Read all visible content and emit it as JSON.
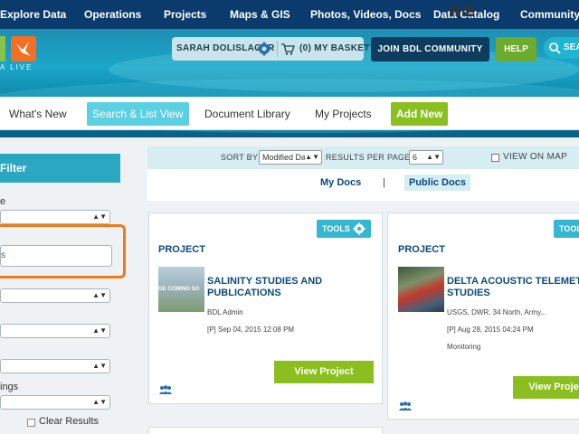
{
  "topnav": {
    "items": [
      "Explore Data",
      "Operations",
      "Projects",
      "Maps & GIS",
      "Photos, Videos, Docs",
      "Data Catalog",
      "Community"
    ]
  },
  "banner": {
    "logo_text": "A LIVE",
    "user_name": "SARAH DOLISLAGER",
    "basket": "(0) MY BASKET",
    "join": "JOIN BDL COMMUNITY",
    "help": "HELP",
    "search": "SEA"
  },
  "subnav": {
    "items": [
      "What's New",
      "Search & List View",
      "Document Library",
      "My Projects"
    ],
    "add": "Add New",
    "active_index": 1
  },
  "sidebar": {
    "filter_title": "Filter",
    "label_1": "e",
    "input_value": "s",
    "label_2": "ings",
    "clear": "Clear Results"
  },
  "toolbar": {
    "sort_by": "SORT BY",
    "sort_value": "Modified Da",
    "results_per_page": "RESULTS PER PAGE",
    "per_page_value": "6",
    "view_on_map": "VIEW ON MAP"
  },
  "doc_tabs": {
    "my_docs": "My Docs",
    "separator": "|",
    "public_docs": "Public Docs"
  },
  "cards": [
    {
      "tools": "TOOLS",
      "type": "PROJECT",
      "thumb_text": "GE COMING SO",
      "title_line1": "SALINITY STUDIES AND",
      "title_line2": "PUBLICATIONS",
      "author": "BDL Admin",
      "date": "[P] Sep 04, 2015 12:08 PM",
      "category": "",
      "button": "View Project"
    },
    {
      "tools": "TOOL",
      "type": "PROJECT",
      "thumb_text": "",
      "title_line1": "DELTA ACOUSTIC TELEMET",
      "title_line2": "STUDIES",
      "author": "USGS, DWR, 34 North, Army...",
      "date": "[P] Aug 28, 2015 04:24 PM",
      "category": "Monitoring",
      "button": "View Proje"
    }
  ],
  "colors": {
    "topnav": "#0b3b6c",
    "accent_teal": "#2aa8c1",
    "accent_green": "#8bbf1f",
    "highlight_orange": "#f07a1a",
    "link_blue": "#0b4a7a"
  }
}
